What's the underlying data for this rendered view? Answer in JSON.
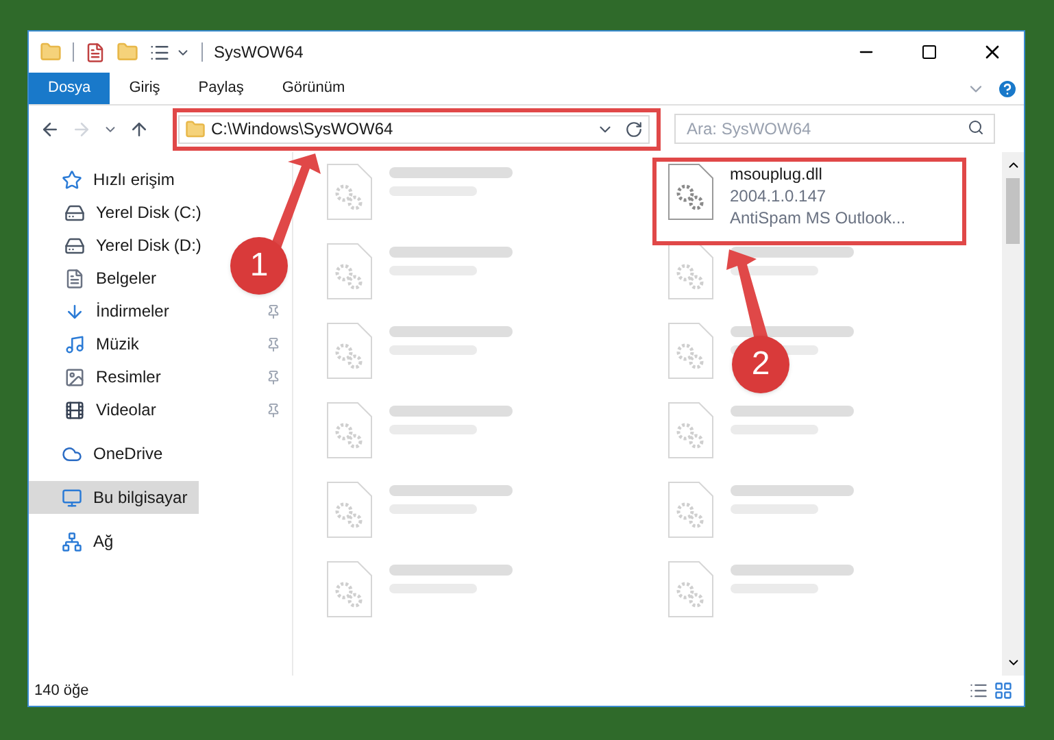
{
  "window": {
    "title": "SysWOW64"
  },
  "ribbon_tabs": [
    {
      "label": "Dosya",
      "selected": true
    },
    {
      "label": "Giriş",
      "selected": false
    },
    {
      "label": "Paylaş",
      "selected": false
    },
    {
      "label": "Görünüm",
      "selected": false
    }
  ],
  "address": {
    "path": "C:\\Windows\\SysWOW64"
  },
  "search": {
    "placeholder": "Ara: SysWOW64"
  },
  "sidebar": {
    "items": [
      {
        "label": "Hızlı erişim",
        "kind": "quick",
        "pinned": false,
        "selected": false,
        "children": [
          {
            "label": "Yerel Disk (C:)",
            "kind": "drive",
            "pinned": false,
            "selected": false
          },
          {
            "label": "Yerel Disk (D:)",
            "kind": "drive",
            "pinned": false,
            "selected": false
          },
          {
            "label": "Belgeler",
            "kind": "docs",
            "pinned": false,
            "selected": false
          },
          {
            "label": "İndirmeler",
            "kind": "download",
            "pinned": true,
            "selected": false
          },
          {
            "label": "Müzik",
            "kind": "music",
            "pinned": true,
            "selected": false
          },
          {
            "label": "Resimler",
            "kind": "pictures",
            "pinned": true,
            "selected": false
          },
          {
            "label": "Videolar",
            "kind": "videos",
            "pinned": true,
            "selected": false
          }
        ]
      },
      {
        "label": "OneDrive",
        "kind": "cloud",
        "pinned": false,
        "selected": false
      },
      {
        "label": "Bu bilgisayar",
        "kind": "pc",
        "pinned": false,
        "selected": true
      },
      {
        "label": "Ağ",
        "kind": "network",
        "pinned": false,
        "selected": false
      }
    ]
  },
  "files": [
    {
      "kind": "blurred"
    },
    {
      "kind": "file",
      "name": "msouplug.dll",
      "lines": [
        "2004.1.0.147",
        "AntiSpam MS Outlook..."
      ]
    },
    {
      "kind": "blurred"
    },
    {
      "kind": "blurred"
    },
    {
      "kind": "blurred"
    },
    {
      "kind": "blurred"
    },
    {
      "kind": "blurred"
    },
    {
      "kind": "blurred"
    },
    {
      "kind": "blurred"
    },
    {
      "kind": "blurred"
    },
    {
      "kind": "blurred"
    },
    {
      "kind": "blurred"
    }
  ],
  "status_bar": {
    "count": "140 öğe"
  },
  "annotations": [
    {
      "number": "1"
    },
    {
      "number": "2"
    }
  ]
}
